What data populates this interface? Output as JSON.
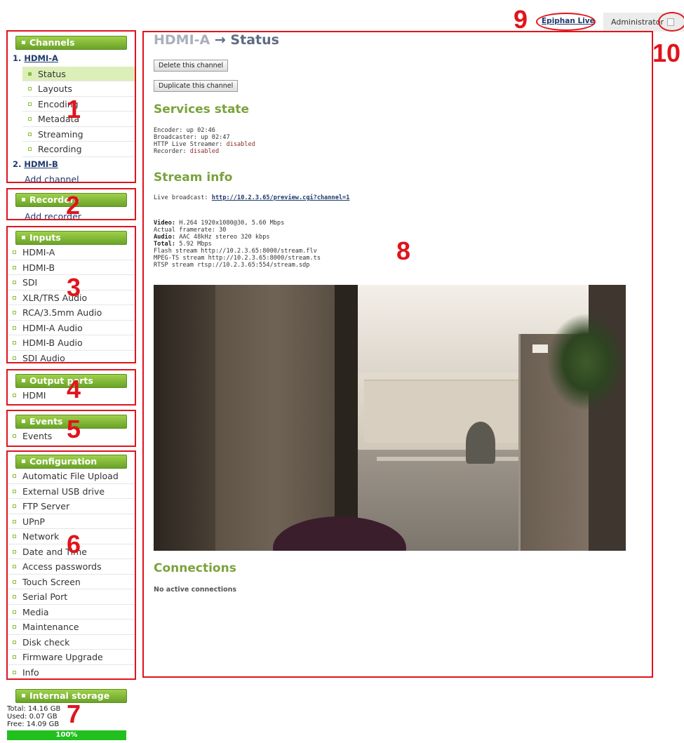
{
  "header": {
    "live_link": "Epiphan Live",
    "admin_label": "Administrator"
  },
  "sidebar": {
    "channels": {
      "title": "Channels",
      "channel1": {
        "num": "1.",
        "name": "HDMI-A"
      },
      "items": [
        "Status",
        "Layouts",
        "Encoding",
        "Metadata",
        "Streaming",
        "Recording"
      ],
      "channel2": {
        "num": "2.",
        "name": "HDMI-B"
      },
      "add": "Add channel"
    },
    "recorders": {
      "title": "Recorders",
      "add": "Add recorder"
    },
    "inputs": {
      "title": "Inputs",
      "items": [
        "HDMI-A",
        "HDMI-B",
        "SDI",
        "XLR/TRS Audio",
        "RCA/3.5mm Audio",
        "HDMI-A Audio",
        "HDMI-B Audio",
        "SDI Audio"
      ]
    },
    "output_ports": {
      "title": "Output ports",
      "items": [
        "HDMI"
      ]
    },
    "events": {
      "title": "Events",
      "items": [
        "Events"
      ]
    },
    "configuration": {
      "title": "Configuration",
      "items": [
        "Automatic File Upload",
        "External USB drive",
        "FTP Server",
        "UPnP",
        "Network",
        "Date and Time",
        "Access passwords",
        "Touch Screen",
        "Serial Port",
        "Media",
        "Maintenance",
        "Disk check",
        "Firmware Upgrade",
        "Info"
      ]
    },
    "storage": {
      "title": "Internal storage",
      "total": "Total: 14.16 GB",
      "used": "Used: 0.07 GB",
      "free": "Free: 14.09 GB",
      "bar_label": "100%",
      "bar_fraction": 1.0
    }
  },
  "main": {
    "title_channel": "HDMI-A",
    "title_arrow": "→",
    "title_page": "Status",
    "delete_button": "Delete this channel",
    "duplicate_button": "Duplicate this channel",
    "services_heading": "Services state",
    "services": {
      "encoder_label": "Encoder: ",
      "encoder_value": "up 02:46",
      "broadcaster_label": "Broadcaster: ",
      "broadcaster_value": "up 02:47",
      "hls_label": "HTTP Live Streamer: ",
      "hls_value": "disabled",
      "recorder_label": "Recorder: ",
      "recorder_value": "disabled"
    },
    "stream_heading": "Stream info",
    "live_broadcast_label": "Live broadcast: ",
    "live_broadcast_url": "http://10.2.3.65/preview.cgi?channel=1",
    "stream": {
      "video_label": "Video:",
      "video_value": " H.264 1920x1080@30, 5.60 Mbps",
      "framerate": "Actual framerate: 30",
      "audio_label": "Audio:",
      "audio_value": " AAC 48kHz stereo 320 kbps",
      "total_label": "Total:",
      "total_value": " 5.92 Mbps",
      "flash": "Flash stream http://10.2.3.65:8000/stream.flv",
      "mpegts": "MPEG-TS stream http://10.2.3.65:8000/stream.ts",
      "rtsp": "RTSP stream rtsp://10.2.3.65:554/stream.sdp"
    },
    "connections_heading": "Connections",
    "connections_text": "No active connections"
  },
  "annotations": [
    "1",
    "2",
    "3",
    "4",
    "5",
    "6",
    "7",
    "8",
    "9",
    "10"
  ],
  "colors": {
    "annotation": "#e0141c",
    "sidebar_header": "#7ab536",
    "heading": "#7aa33c",
    "link": "#1f3a6b"
  }
}
